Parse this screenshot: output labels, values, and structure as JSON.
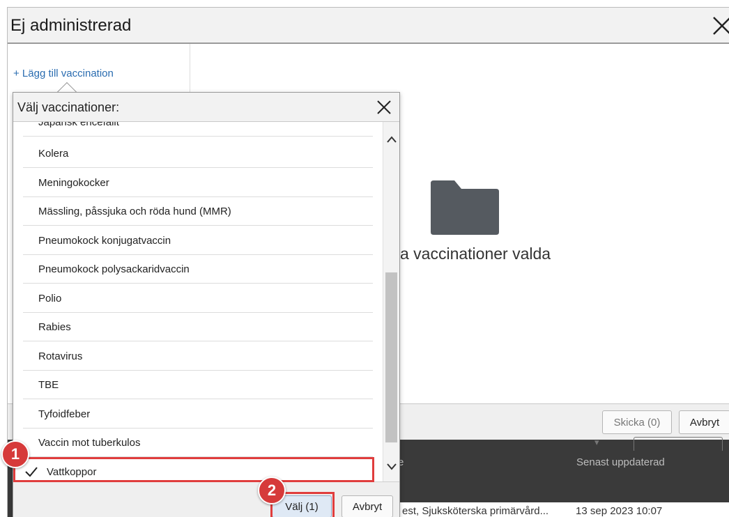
{
  "modal": {
    "title": "Ej administrerad",
    "add_link": "+ Lägg till vaccination",
    "empty_text": "a vaccinationer valda",
    "footer": {
      "skicka_label": "Skicka (0)",
      "avbryt_label": "Avbryt"
    }
  },
  "background_table": {
    "header_partial": "e",
    "header_senast": "Senast uppdaterad",
    "row": {
      "name": "est, Sjuksköterska primärvård...",
      "date": "13 sep 2023 10:07"
    }
  },
  "popup": {
    "title": "Välj vaccinationer:",
    "items": [
      {
        "label": "Japansk encefalit",
        "selected": false
      },
      {
        "label": "Kolera",
        "selected": false
      },
      {
        "label": "Meningokocker",
        "selected": false
      },
      {
        "label": "Mässling, påssjuka och röda hund (MMR)",
        "selected": false
      },
      {
        "label": "Pneumokock konjugatvaccin",
        "selected": false
      },
      {
        "label": "Pneumokock polysackaridvaccin",
        "selected": false
      },
      {
        "label": "Polio",
        "selected": false
      },
      {
        "label": "Rabies",
        "selected": false
      },
      {
        "label": "Rotavirus",
        "selected": false
      },
      {
        "label": "TBE",
        "selected": false
      },
      {
        "label": "Tyfoidfeber",
        "selected": false
      },
      {
        "label": "Vaccin mot tuberkulos",
        "selected": false
      },
      {
        "label": "Vattkoppor",
        "selected": true
      }
    ],
    "footer": {
      "valj_label": "Välj (1)",
      "avbryt_label": "Avbryt"
    }
  },
  "annotations": {
    "badge_1": "1",
    "badge_2": "2"
  },
  "colors": {
    "link": "#2a6cb0",
    "highlight": "#e03d3d",
    "folder": "#555a60"
  }
}
